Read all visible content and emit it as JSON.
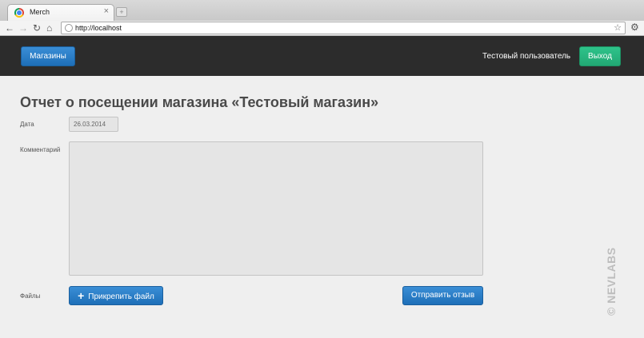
{
  "browser": {
    "tab_title": "Merch",
    "tab_close": "×",
    "new_tab": "+",
    "url": "http://localhost",
    "icons": [
      "back-icon",
      "forward-icon",
      "reload-icon",
      "home-icon",
      "globe-icon",
      "star-icon",
      "wrench-icon"
    ]
  },
  "navbar": {
    "stores_label": "Магазины",
    "user_name": "Тестовый пользователь",
    "logout_label": "Выход"
  },
  "page": {
    "title": "Отчет о посещении магазина «Тестовый магазин»",
    "date_label": "Дата",
    "date_value": "26.03.2014",
    "comment_label": "Комментарий",
    "comment_value": "",
    "files_label": "Файлы",
    "attach_label": "Прикрепить файл",
    "send_label": "Отправить отзыв"
  },
  "watermark": "© NEVLABS",
  "colors": {
    "navbar": "#2c2c2c",
    "primary_button": "#1e6fb8",
    "logout_button": "#22a874",
    "background": "#efefef"
  }
}
